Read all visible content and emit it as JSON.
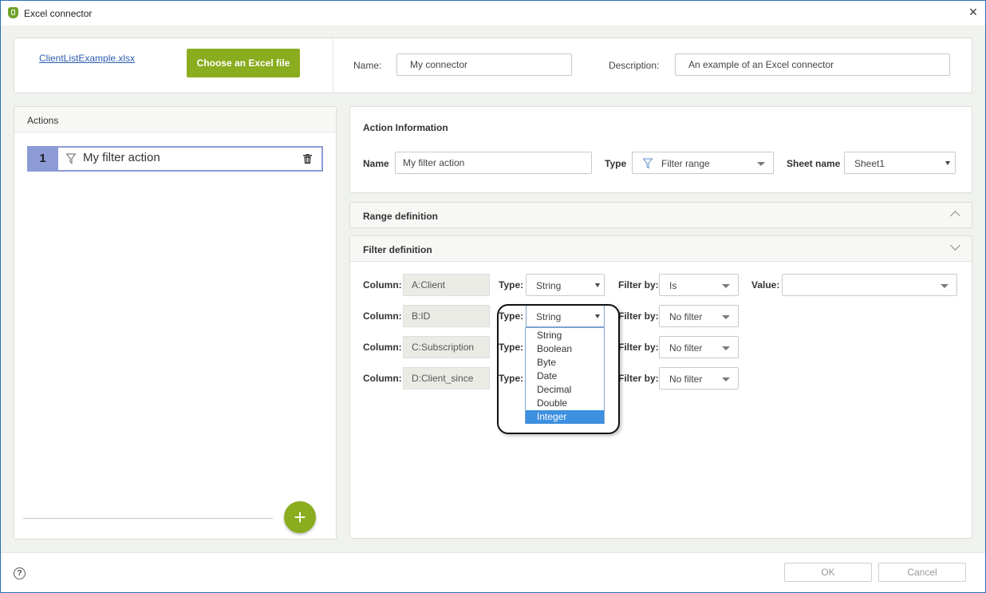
{
  "window": {
    "title": "Excel connector"
  },
  "top_panel": {
    "file_link": "ClientListExample.xlsx",
    "choose_button": "Choose an Excel file",
    "name_label": "Name:",
    "name_value": "My connector",
    "description_label": "Description:",
    "description_value": "An example of an Excel connector"
  },
  "actions_panel": {
    "header": "Actions",
    "items": [
      {
        "number": "1",
        "label": "My filter action"
      }
    ],
    "add_button": "+"
  },
  "action_info": {
    "header": "Action Information",
    "name_label": "Name",
    "name_value": "My filter action",
    "type_label": "Type",
    "type_value": "Filter range",
    "sheet_label": "Sheet name",
    "sheet_value": "Sheet1"
  },
  "range_definition": {
    "header": "Range definition"
  },
  "filter_definition": {
    "header": "Filter definition",
    "column_label": "Column:",
    "type_label": "Type:",
    "filterby_label": "Filter by:",
    "value_label": "Value:",
    "rows": [
      {
        "column": "A:Client",
        "type": "String",
        "filter_by": "Is"
      },
      {
        "column": "B:ID",
        "type": "String",
        "filter_by": "No filter"
      },
      {
        "column": "C:Subscription",
        "filter_by": "No filter"
      },
      {
        "column": "D:Client_since",
        "filter_by": "No filter"
      }
    ],
    "type_dropdown": {
      "options": [
        "String",
        "Boolean",
        "Byte",
        "Date",
        "Decimal",
        "Double",
        "Integer"
      ],
      "highlighted": "Integer"
    }
  },
  "footer": {
    "ok": "OK",
    "cancel": "Cancel",
    "help": "?"
  },
  "colors": {
    "accent_green": "#8aac1f",
    "window_border": "#2b6fb6",
    "selection_blue": "#3d8fe0",
    "action_number_bg": "#8c9bd6"
  }
}
